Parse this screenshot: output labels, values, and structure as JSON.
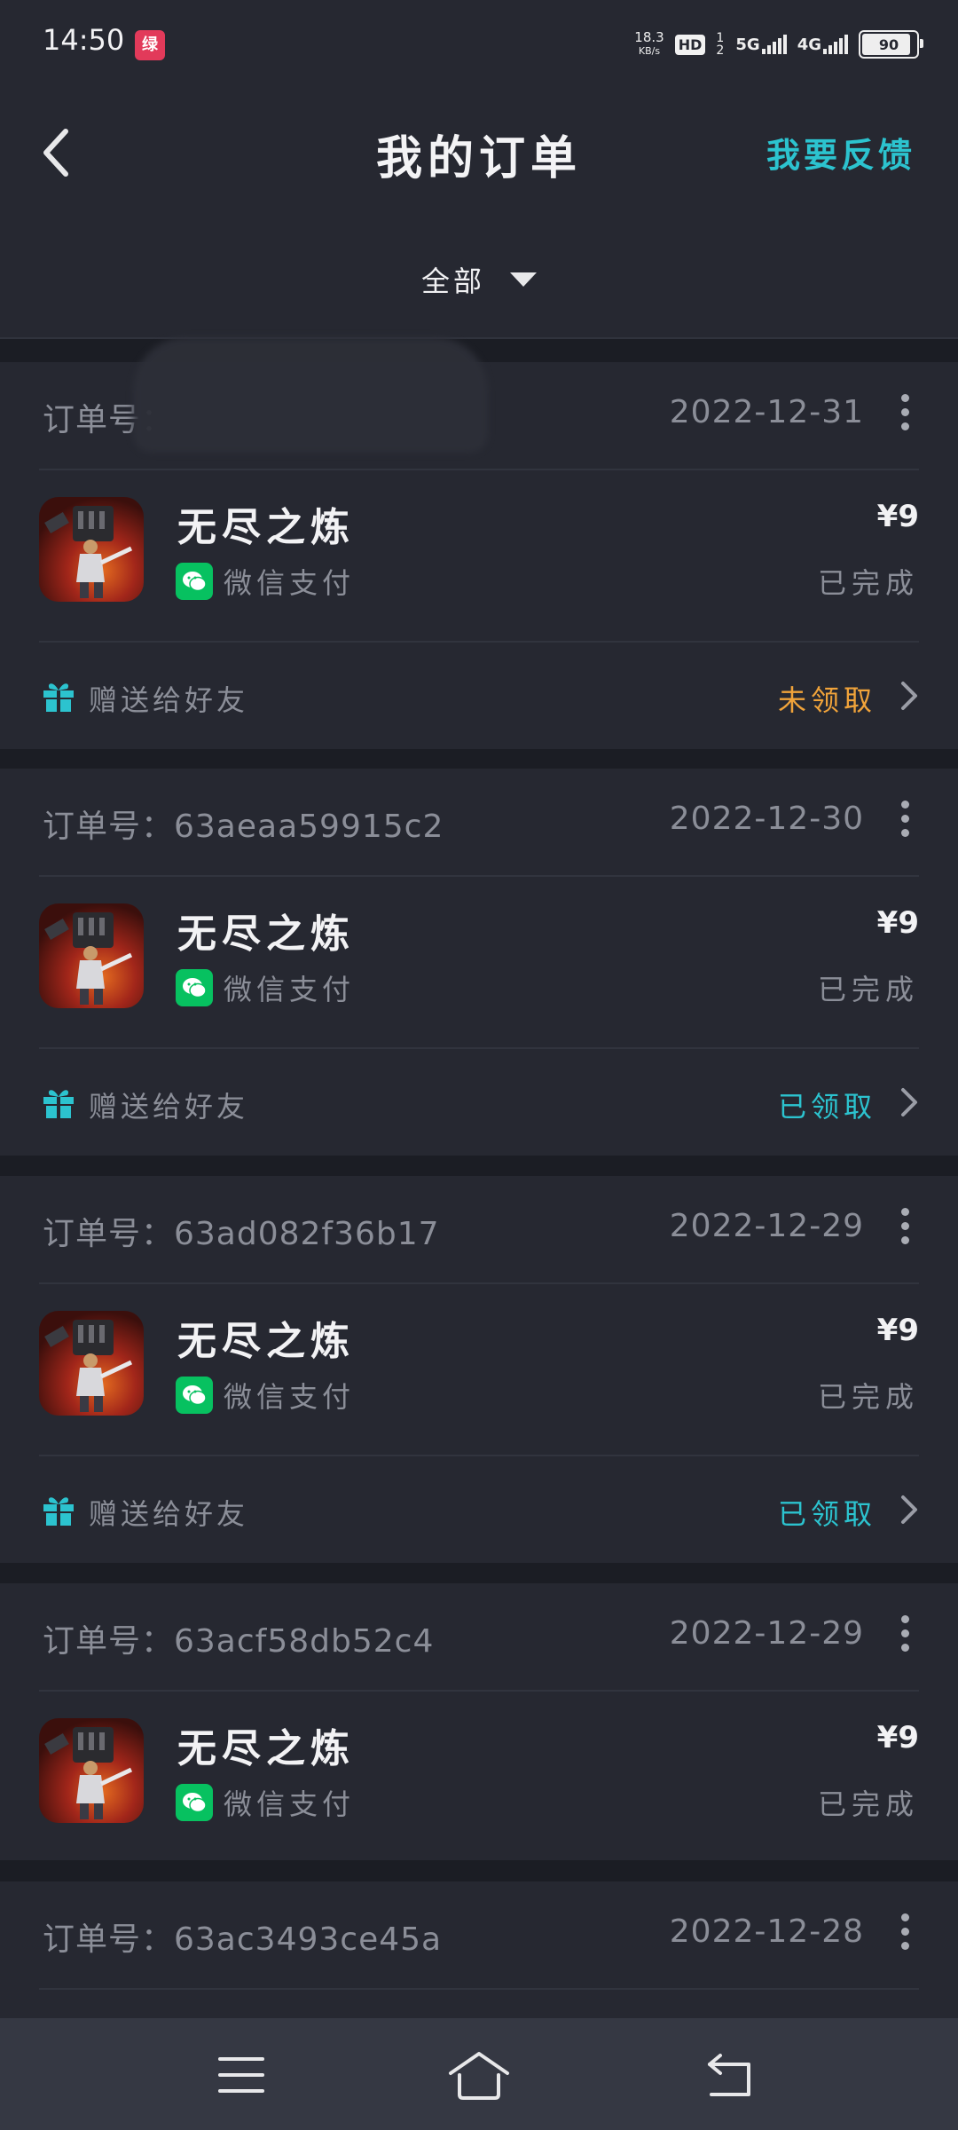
{
  "status_bar": {
    "time": "14:50",
    "notification_icon": "绿",
    "net_speed_value": "18.3",
    "net_speed_unit": "KB/s",
    "hd_label": "HD",
    "hd_sub": "12",
    "network_1": "5G",
    "network_2": "4G",
    "battery": "90",
    "battery_level": 0.9
  },
  "header": {
    "title": "我的订单",
    "feedback_label": "我要反馈",
    "filter_label": "全部",
    "back_icon": "chevron-left-icon"
  },
  "orders": [
    {
      "order_no": "订单号：",
      "date": "2022-12-31",
      "game_name": "无尽之炼",
      "pay_method": "微信支付",
      "price": "¥9",
      "status": "已完成",
      "gift_label": "赠送给好友",
      "gift_status": "未领取",
      "gift_status_color": "#f0a33a"
    },
    {
      "order_no": "订单号：63aeaa59915c2",
      "date": "2022-12-30",
      "game_name": "无尽之炼",
      "pay_method": "微信支付",
      "price": "¥9",
      "status": "已完成",
      "gift_label": "赠送给好友",
      "gift_status": "已领取",
      "gift_status_color": "#2cc3cf"
    },
    {
      "order_no": "订单号：63ad082f36b17",
      "date": "2022-12-29",
      "game_name": "无尽之炼",
      "pay_method": "微信支付",
      "price": "¥9",
      "status": "已完成",
      "gift_label": "赠送给好友",
      "gift_status": "已领取",
      "gift_status_color": "#2cc3cf"
    },
    {
      "order_no": "订单号：63acf58db52c4",
      "date": "2022-12-29",
      "game_name": "无尽之炼",
      "pay_method": "微信支付",
      "price": "¥9",
      "status": "已完成"
    },
    {
      "order_no": "订单号：63ac3493ce45a",
      "date": "2022-12-28"
    }
  ],
  "colors": {
    "accent": "#2cc3cf",
    "pending": "#f0a33a",
    "background": "#1b1d24",
    "card": "#262831",
    "wechat": "#07c160"
  },
  "nav": {
    "menu_icon": "menu-icon",
    "home_icon": "home-icon",
    "back_icon": "back-arrow-icon"
  }
}
